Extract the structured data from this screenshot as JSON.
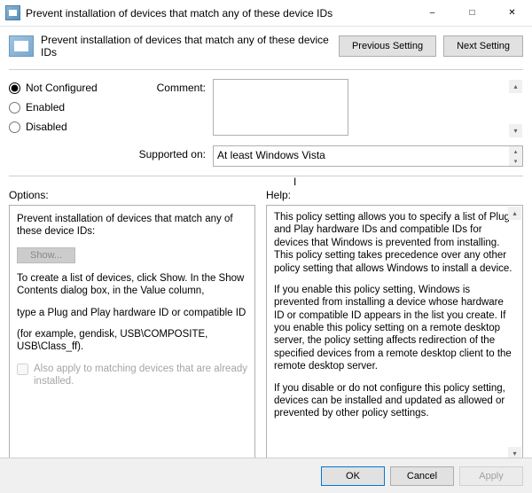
{
  "window": {
    "title": "Prevent installation of devices that match any of these device IDs"
  },
  "header": {
    "title": "Prevent installation of devices that match any of these device IDs",
    "prev_btn": "Previous Setting",
    "next_btn": "Next Setting"
  },
  "state": {
    "not_configured": "Not Configured",
    "enabled": "Enabled",
    "disabled": "Disabled",
    "selected": "not_configured",
    "comment_label": "Comment:",
    "comment_value": "",
    "supported_label": "Supported on:",
    "supported_value": "At least Windows Vista"
  },
  "labels": {
    "options": "Options:",
    "help": "Help:"
  },
  "options": {
    "intro": "Prevent installation of devices that match any of these device IDs:",
    "show_btn": "Show...",
    "hint1": "To create a list of devices, click Show. In the Show Contents dialog box, in the Value column,",
    "hint2": "type a Plug and Play hardware ID or compatible ID",
    "hint3": "(for example, gendisk, USB\\COMPOSITE, USB\\Class_ff).",
    "chk_label": "Also apply to matching devices that are already installed."
  },
  "help": {
    "p1": "This policy setting allows you to specify a list of Plug and Play hardware IDs and compatible IDs for devices that Windows is prevented from installing. This policy setting takes precedence over any other policy setting that allows Windows to install a device.",
    "p2": "If you enable this policy setting, Windows is prevented from installing a device whose hardware ID or compatible ID appears in the list you create. If you enable this policy setting on a remote desktop server, the policy setting affects redirection of the specified devices from a remote desktop client to the remote desktop server.",
    "p3": "If you disable or do not configure this policy setting, devices can be installed and updated as allowed or prevented by other policy settings."
  },
  "footer": {
    "ok": "OK",
    "cancel": "Cancel",
    "apply": "Apply"
  }
}
